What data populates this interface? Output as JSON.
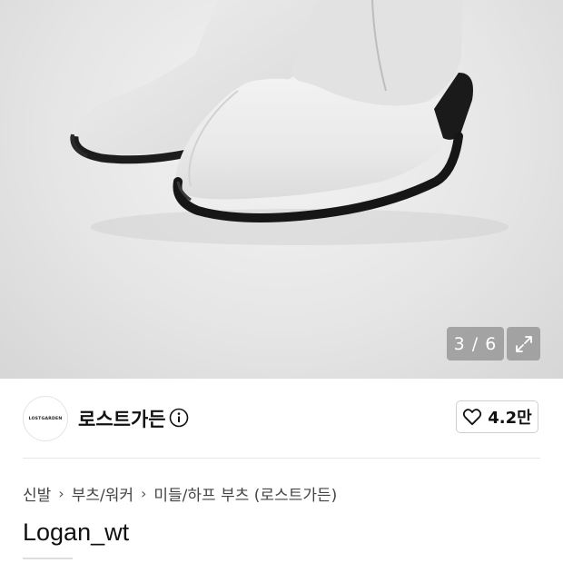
{
  "gallery": {
    "counter": "3 / 6",
    "expand_icon": "expand-icon"
  },
  "brand": {
    "logo_text": "LOSTGARDEN",
    "name": "로스트가든",
    "info_icon": "info-icon"
  },
  "like": {
    "icon": "heart-outline-icon",
    "count": "4.2만"
  },
  "breadcrumb": {
    "items": [
      "신발",
      "부츠/워커",
      "미들/하프 부츠 (로스트가든)"
    ],
    "separator_icon": "chevron-right-icon"
  },
  "product": {
    "title": "Logan_wt"
  }
}
